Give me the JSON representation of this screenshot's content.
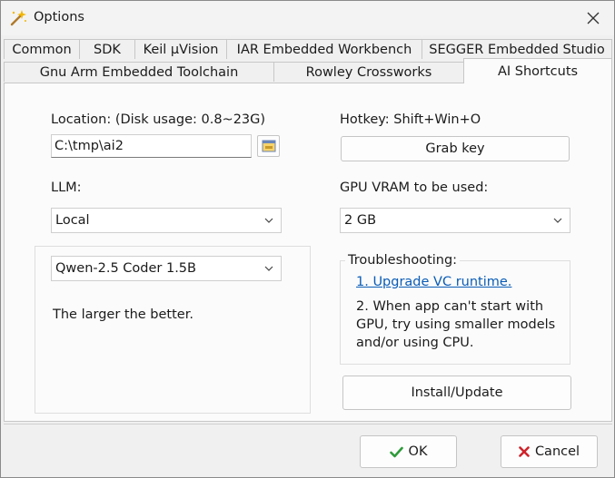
{
  "window": {
    "title": "Options"
  },
  "tabs": {
    "row1": [
      "Common",
      "SDK",
      "Keil µVision",
      "IAR Embedded Workbench",
      "SEGGER Embedded Studio"
    ],
    "row2": [
      "Gnu Arm Embedded Toolchain",
      "Rowley Crossworks",
      "AI Shortcuts"
    ],
    "active": "AI Shortcuts"
  },
  "location": {
    "label": "Location: (Disk usage: 0.8~23G)",
    "value": "C:\\tmp\\ai2"
  },
  "llm": {
    "label": "LLM:",
    "selected": "Local"
  },
  "model": {
    "selected": "Qwen-2.5 Coder 1.5B",
    "hint": "The larger the better."
  },
  "hotkey": {
    "label": "Hotkey: Shift+Win+O",
    "grab_label": "Grab key"
  },
  "gpu": {
    "label": "GPU VRAM to be used:",
    "selected": "2 GB"
  },
  "troubleshooting": {
    "title": "Troubleshooting:",
    "link": "1. Upgrade VC runtime.",
    "line1": "2. When app can't start with",
    "line2": "GPU, try using smaller models",
    "line3": "and/or using CPU."
  },
  "install_label": "Install/Update",
  "footer": {
    "ok_label": "OK",
    "cancel_label": "Cancel"
  },
  "icons": {
    "title": "magic-wand-icon",
    "ok": "checkmark-icon",
    "cancel": "x-icon",
    "browse": "folder-browse-icon"
  },
  "colors": {
    "ok_green": "#2e9b3a",
    "cancel_red": "#d0232b",
    "link_blue": "#0a5cb6"
  }
}
